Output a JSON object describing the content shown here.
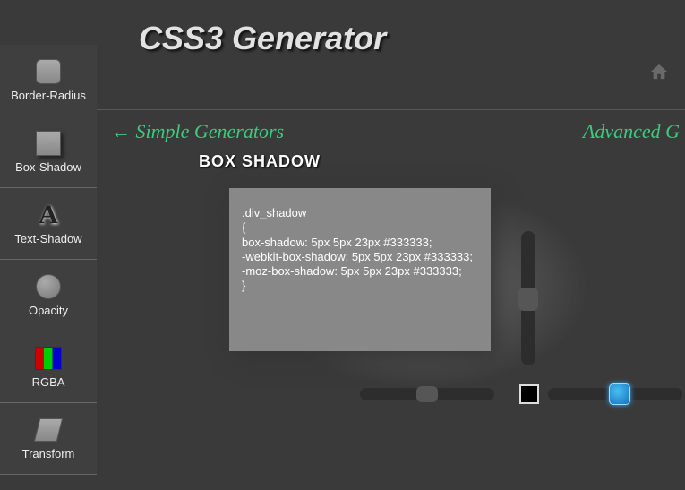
{
  "title": "CSS3 Generator",
  "nav": {
    "left": "← Simple Generators",
    "right": "Advanced G"
  },
  "section_title": "BOX SHADOW",
  "sidebar": {
    "items": [
      {
        "label": "Border-Radius"
      },
      {
        "label": "Box-Shadow"
      },
      {
        "label": "Text-Shadow"
      },
      {
        "label": "Opacity"
      },
      {
        "label": "RGBA"
      },
      {
        "label": "Transform"
      }
    ]
  },
  "code": {
    "selector": ".div_shadow",
    "open": "{",
    "rule1": "box-shadow: 5px 5px 23px #333333;",
    "rule2": "-webkit-box-shadow: 5px 5px 23px #333333;",
    "rule3": "-moz-box-shadow: 5px 5px 23px #333333;",
    "close": "}"
  },
  "controls": {
    "swatch_color": "#000000",
    "slider_color_value": "#333333"
  }
}
